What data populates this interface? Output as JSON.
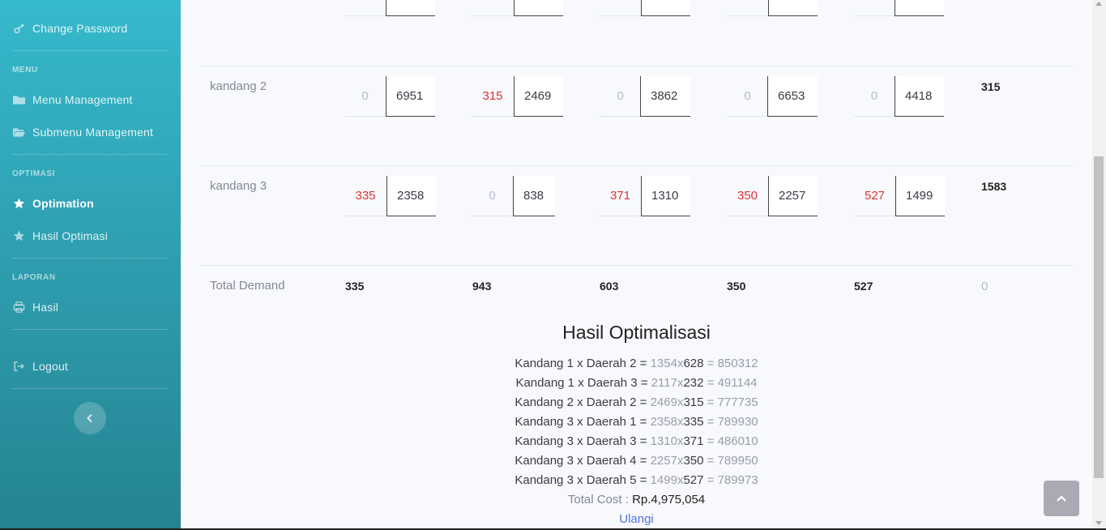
{
  "sidebar": {
    "change_password": "Change Password",
    "menu_heading": "MENU",
    "menu_management": "Menu Management",
    "submenu_management": "Submenu Management",
    "optimasi_heading": "OPTIMASI",
    "optimation": "Optimation",
    "hasil_optimasi": "Hasil Optimasi",
    "laporan_heading": "LAPORAN",
    "hasil": "Hasil",
    "logout": "Logout"
  },
  "table": {
    "rows": [
      {
        "label": "kandang 2",
        "cells": [
          {
            "alloc": "0",
            "cost": "6951"
          },
          {
            "alloc": "315",
            "cost": "2469"
          },
          {
            "alloc": "0",
            "cost": "3862"
          },
          {
            "alloc": "0",
            "cost": "6653"
          },
          {
            "alloc": "0",
            "cost": "4418"
          }
        ],
        "supply": "315"
      },
      {
        "label": "kandang 3",
        "cells": [
          {
            "alloc": "335",
            "cost": "2358"
          },
          {
            "alloc": "0",
            "cost": "838"
          },
          {
            "alloc": "371",
            "cost": "1310"
          },
          {
            "alloc": "350",
            "cost": "2257"
          },
          {
            "alloc": "527",
            "cost": "1499"
          }
        ],
        "supply": "1583"
      }
    ],
    "total_demand_label": "Total Demand",
    "demand": [
      "335",
      "943",
      "603",
      "350",
      "527"
    ],
    "demand_total": "0"
  },
  "result": {
    "title": "Hasil Optimalisasi",
    "lines": [
      {
        "label": "Kandang 1 x Daerah 2 =",
        "cost": "1354",
        "x": "x",
        "alloc": "628",
        "eq": "=",
        "result": "850312"
      },
      {
        "label": "Kandang 1 x Daerah 3 =",
        "cost": "2117",
        "x": "x",
        "alloc": "232",
        "eq": "=",
        "result": "491144"
      },
      {
        "label": "Kandang 2 x Daerah 2 =",
        "cost": "2469",
        "x": "x",
        "alloc": "315",
        "eq": "=",
        "result": "777735"
      },
      {
        "label": "Kandang 3 x Daerah 1 =",
        "cost": "2358",
        "x": "x",
        "alloc": "335",
        "eq": "=",
        "result": "789930"
      },
      {
        "label": "Kandang 3 x Daerah 3 =",
        "cost": "1310",
        "x": "x",
        "alloc": "371",
        "eq": "=",
        "result": "486010"
      },
      {
        "label": "Kandang 3 x Daerah 4 =",
        "cost": "2257",
        "x": "x",
        "alloc": "350",
        "eq": "=",
        "result": "789950"
      },
      {
        "label": "Kandang 3 x Daerah 5 =",
        "cost": "1499",
        "x": "x",
        "alloc": "527",
        "eq": "=",
        "result": "789973"
      }
    ],
    "total_cost_label": "Total Cost :",
    "total_cost_value": "Rp.4,975,054",
    "ulangi": "Ulangi"
  }
}
